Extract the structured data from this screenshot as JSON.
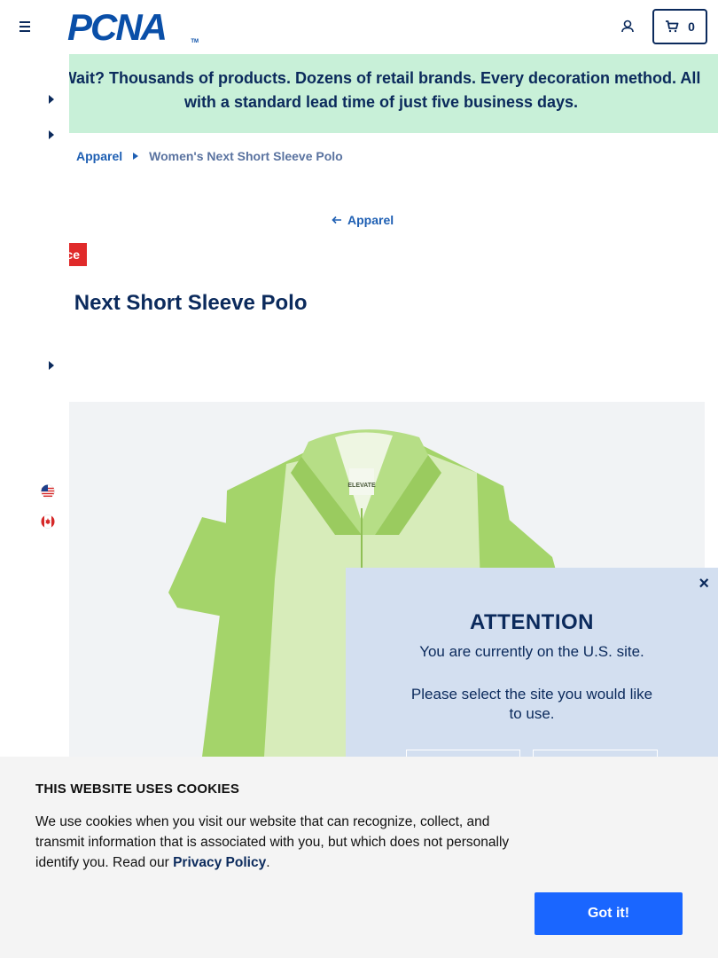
{
  "header": {
    "logo_text": "PCNA",
    "logo_tm": "TM",
    "cart_count": "0"
  },
  "promo": {
    "text": "Wait? Thousands of products. Dozens of retail brands. Every decoration method. All with a standard lead time of just five business days."
  },
  "breadcrumb": {
    "items": [
      "Apparel",
      "Women's Next Short Sleeve Polo"
    ]
  },
  "back_link": "Apparel",
  "badge": "ce",
  "product": {
    "title": "en's Next Short Sleeve Polo",
    "image_brand_label": "ELEVATE"
  },
  "modal": {
    "close_label": "×",
    "title": "ATTENTION",
    "message": "You are currently on the U.S. site.",
    "prompt": "Please select the site you would like to use."
  },
  "cookie": {
    "title": "THIS WEBSITE USES COOKIES",
    "body": "We use cookies when you visit our website that can recognize, collect, and transmit information that is associated with you, but which does not personally identify you. Read our ",
    "link_label": "Privacy Policy",
    "body_end": ".",
    "button_label": "Got it!"
  },
  "colors": {
    "navy": "#0b2a5c",
    "brand_blue": "#0a4fa8",
    "promo_bg": "#c8f0d8",
    "badge_red": "#e02a2a",
    "modal_bg": "#d3dff0",
    "cookie_button": "#1a66ff",
    "polo_green": "#a4d46a"
  }
}
